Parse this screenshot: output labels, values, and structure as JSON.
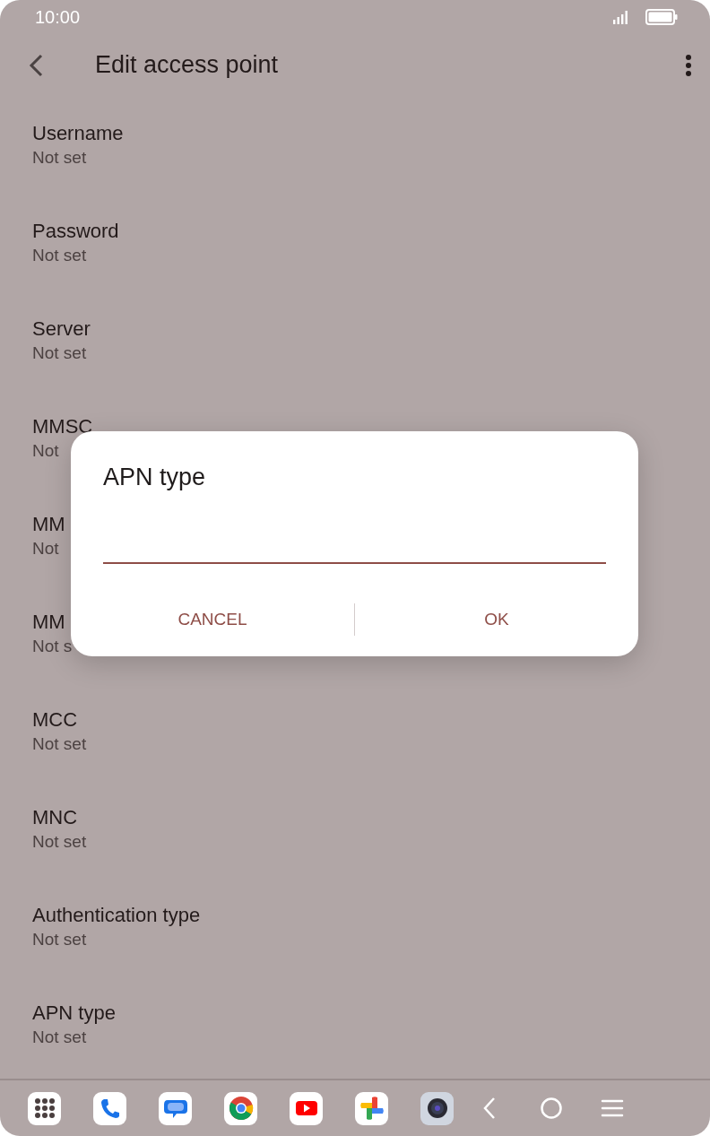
{
  "status_bar": {
    "time": "10:00"
  },
  "toolbar": {
    "title": "Edit access point"
  },
  "settings": [
    {
      "title": "Username",
      "value": "Not set"
    },
    {
      "title": "Password",
      "value": "Not set"
    },
    {
      "title": "Server",
      "value": "Not set"
    },
    {
      "title": "MMSC",
      "value": "Not"
    },
    {
      "title": "MM",
      "value": "Not"
    },
    {
      "title": "MM",
      "value": "Not s"
    },
    {
      "title": "MCC",
      "value": "Not set"
    },
    {
      "title": "MNC",
      "value": "Not set"
    },
    {
      "title": "Authentication type",
      "value": "Not set"
    },
    {
      "title": "APN type",
      "value": "Not set"
    }
  ],
  "dialog": {
    "title": "APN type",
    "buttons": [
      "CANCEL",
      "OK"
    ]
  },
  "taskbar": [
    {
      "kind": "apps"
    },
    {
      "kind": "phone"
    },
    {
      "kind": "messages"
    },
    {
      "kind": "browser"
    },
    {
      "kind": "video"
    },
    {
      "kind": "photos"
    },
    {
      "kind": "camera"
    },
    {
      "kind": "back"
    },
    {
      "kind": "home"
    },
    {
      "kind": "recents"
    }
  ]
}
